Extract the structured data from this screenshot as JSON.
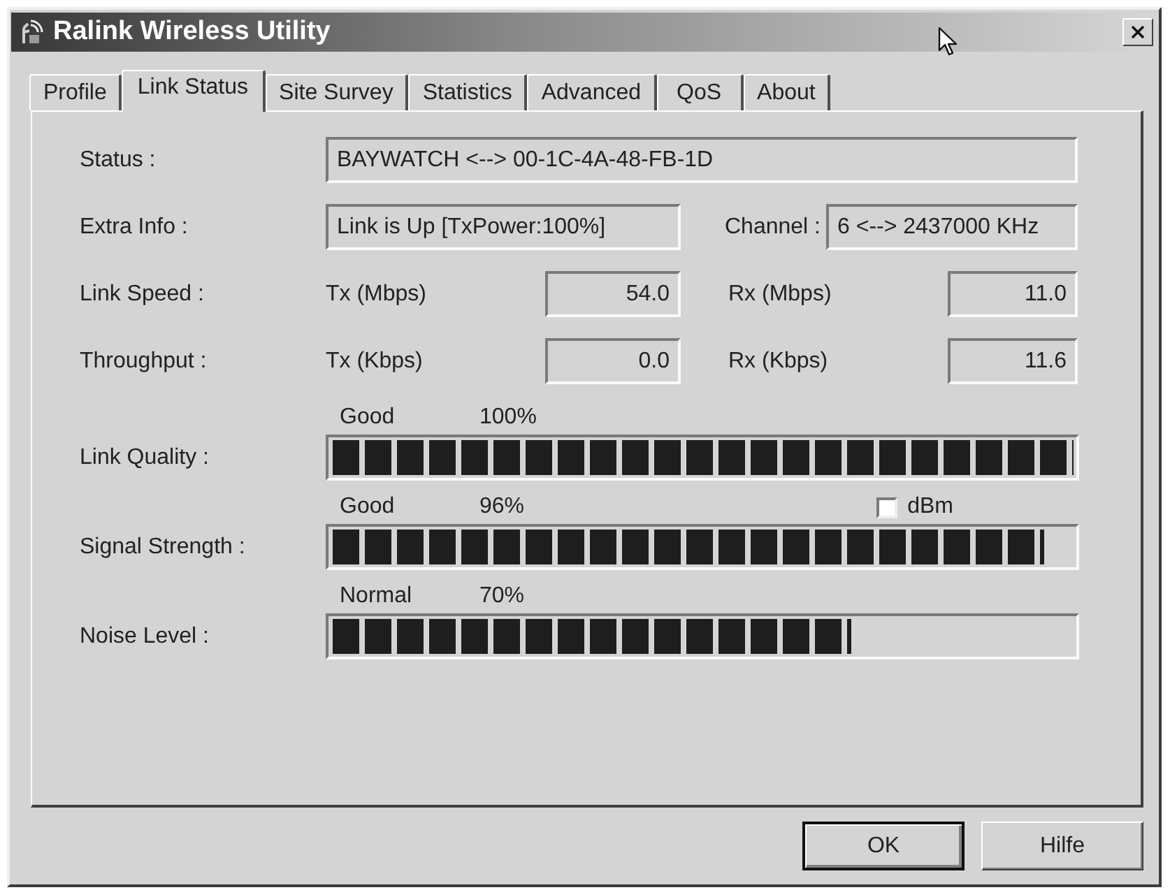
{
  "window": {
    "title": "Ralink Wireless Utility"
  },
  "tabs": [
    {
      "label": "Profile",
      "selected": false
    },
    {
      "label": "Link Status",
      "selected": true
    },
    {
      "label": "Site Survey",
      "selected": false
    },
    {
      "label": "Statistics",
      "selected": false
    },
    {
      "label": "Advanced",
      "selected": false
    },
    {
      "label": "QoS",
      "selected": false
    },
    {
      "label": "About",
      "selected": false
    }
  ],
  "link_status": {
    "status": {
      "label": "Status :",
      "value": "BAYWATCH <--> 00-1C-4A-48-FB-1D"
    },
    "extra_info": {
      "label": "Extra Info :",
      "value": "Link is Up [TxPower:100%]"
    },
    "channel": {
      "label": "Channel :",
      "value": "6 <--> 2437000 KHz"
    },
    "rates": [
      {
        "label": "Link Speed :",
        "tx_label": "Tx (Mbps)",
        "tx": "54.0",
        "rx_label": "Rx (Mbps)",
        "rx": "11.0"
      },
      {
        "label": "Throughput :",
        "tx_label": "Tx (Kbps)",
        "tx": "0.0",
        "rx_label": "Rx (Kbps)",
        "rx": "11.6"
      }
    ],
    "meters": [
      {
        "label": "Link Quality :",
        "rating": "Good",
        "reading": "100%",
        "level": 1
      },
      {
        "label": "Signal Strength :",
        "rating": "Good",
        "reading": "96%",
        "level": 0.96,
        "option": {
          "label": "dBm",
          "checked": false
        }
      },
      {
        "label": "Noise Level :",
        "rating": "Normal",
        "reading": "70%",
        "level": 0.7
      }
    ]
  },
  "buttons": [
    {
      "label": "OK",
      "default": true
    },
    {
      "label": "Hilfe",
      "default": false
    }
  ]
}
